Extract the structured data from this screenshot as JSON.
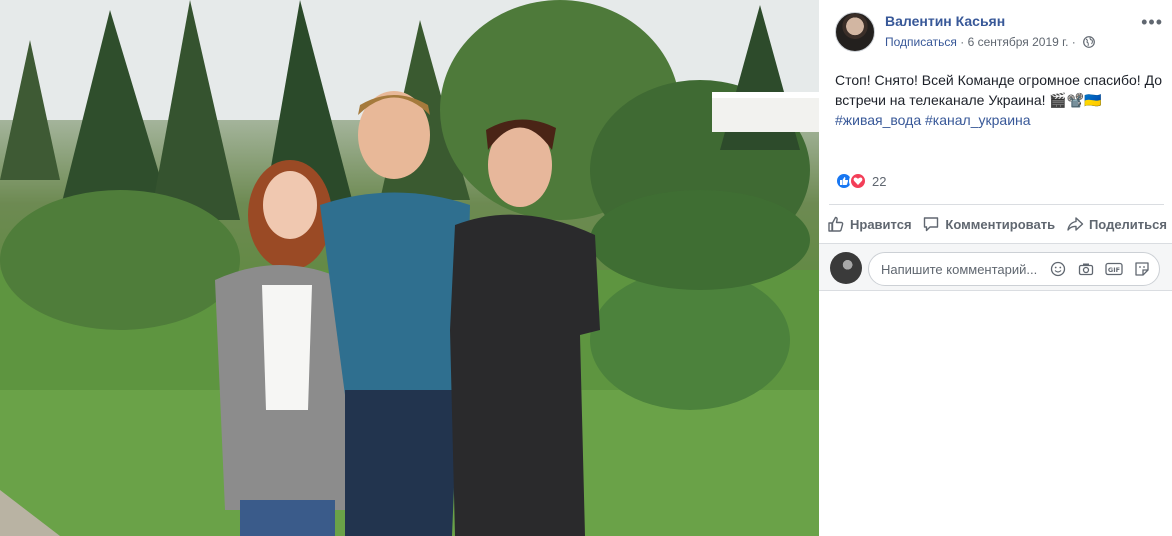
{
  "post": {
    "author": "Валентин Касьян",
    "follow_label": "Подписаться",
    "separator": " · ",
    "date": "6 сентября 2019 г.",
    "separator2": " · ",
    "text": "Стоп! Снято! Всей Команде огромное спасибо! До встречи на телеканале Украина! 🎬📽️🇺🇦",
    "hashtags": [
      "#живая_вода",
      "#канал_украина"
    ],
    "reaction_count": "22"
  },
  "actions": {
    "like": "Нравится",
    "comment": "Комментировать",
    "share": "Поделиться"
  },
  "comment": {
    "placeholder": "Напишите комментарий..."
  },
  "icons": {
    "more": "more-options-icon",
    "privacy": "globe-icon",
    "reactions": [
      "like-reaction-icon",
      "love-reaction-icon"
    ],
    "comment_tools": [
      "emoji-icon",
      "camera-icon",
      "gif-icon",
      "sticker-icon"
    ]
  },
  "colors": {
    "link": "#385898",
    "like_blue": "#1877f2",
    "love_red": "#f33e58",
    "muted": "#606770"
  }
}
